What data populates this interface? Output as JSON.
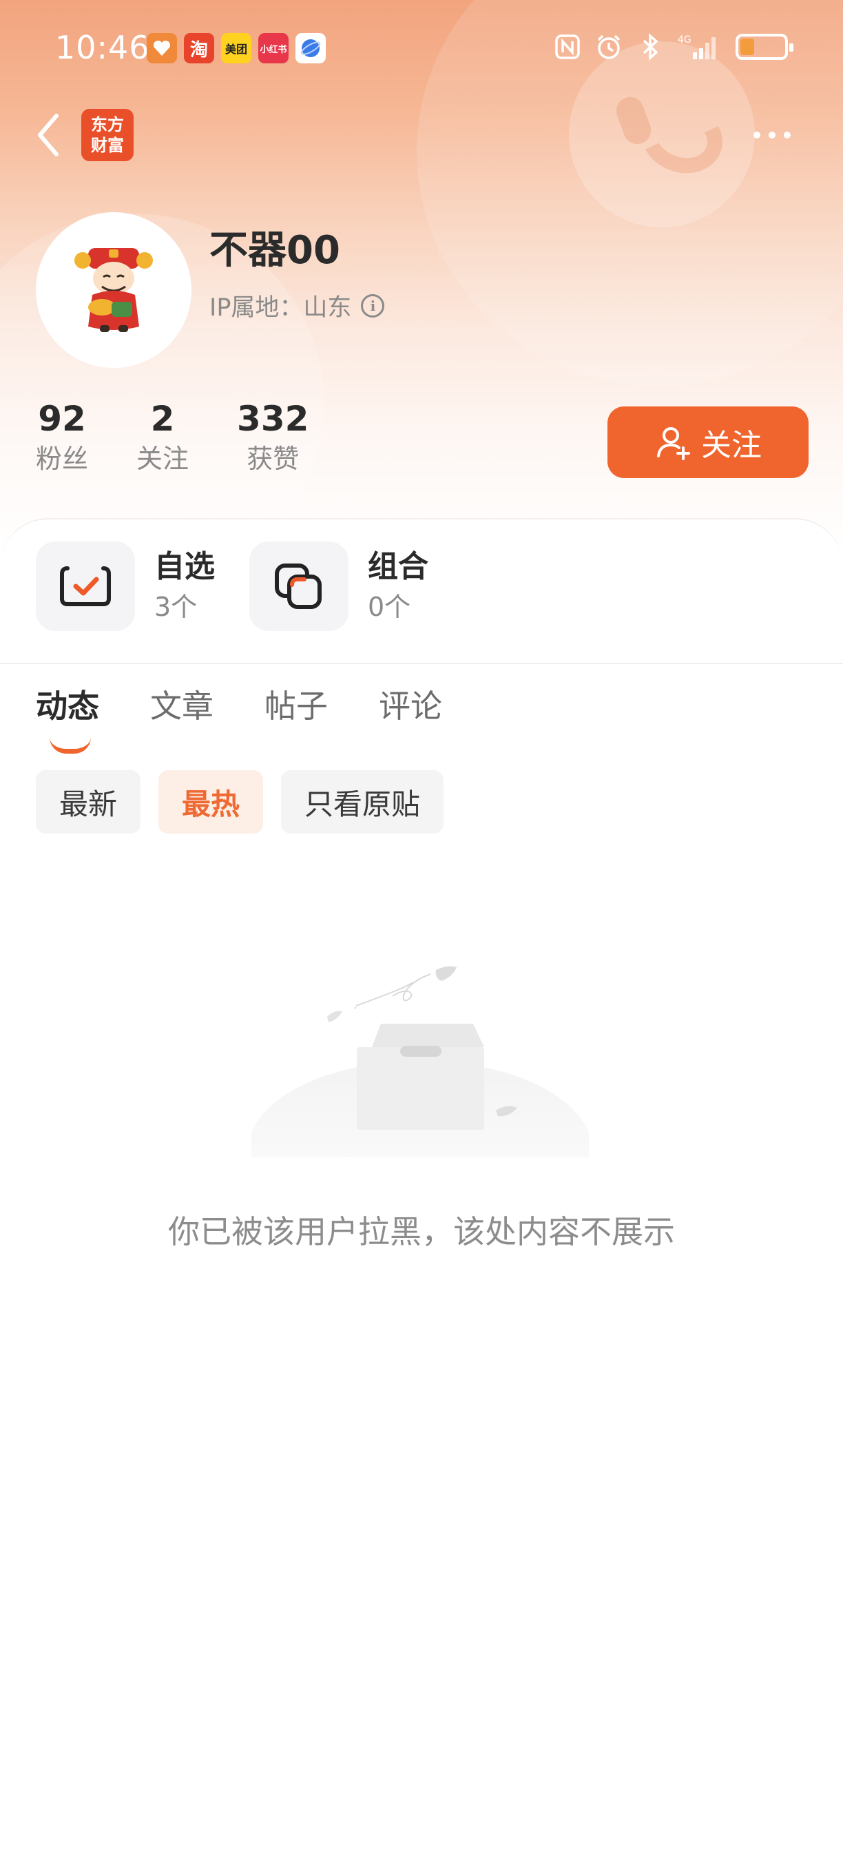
{
  "status_bar": {
    "time": "10:46",
    "app_icons": [
      "alipay-icon",
      "taobao-icon",
      "meituan-icon",
      "xiaohongshu-icon",
      "browser-icon"
    ],
    "meituan_label": "美团",
    "taobao_label": "淘",
    "xiaohongshu_label": "小红书",
    "network_label": "4G"
  },
  "nav": {
    "brand_line1": "东方",
    "brand_line2": "财富"
  },
  "profile": {
    "username": "不器00",
    "ip_label": "IP属地：山东"
  },
  "stats": [
    {
      "value": "92",
      "label": "粉丝"
    },
    {
      "value": "2",
      "label": "关注"
    },
    {
      "value": "332",
      "label": "获赞"
    }
  ],
  "follow_button": {
    "label": "关注"
  },
  "cards": [
    {
      "title": "自选",
      "sub": "3个"
    },
    {
      "title": "组合",
      "sub": "0个"
    }
  ],
  "tabs": [
    {
      "label": "动态",
      "active": true
    },
    {
      "label": "文章",
      "active": false
    },
    {
      "label": "帖子",
      "active": false
    },
    {
      "label": "评论",
      "active": false
    }
  ],
  "filters": [
    {
      "label": "最新",
      "active": false
    },
    {
      "label": "最热",
      "active": true
    },
    {
      "label": "只看原贴",
      "active": false
    }
  ],
  "empty_state": {
    "message": "你已被该用户拉黑，该处内容不展示"
  },
  "colors": {
    "accent": "#f0642e",
    "header_top": "#f2a47e"
  }
}
